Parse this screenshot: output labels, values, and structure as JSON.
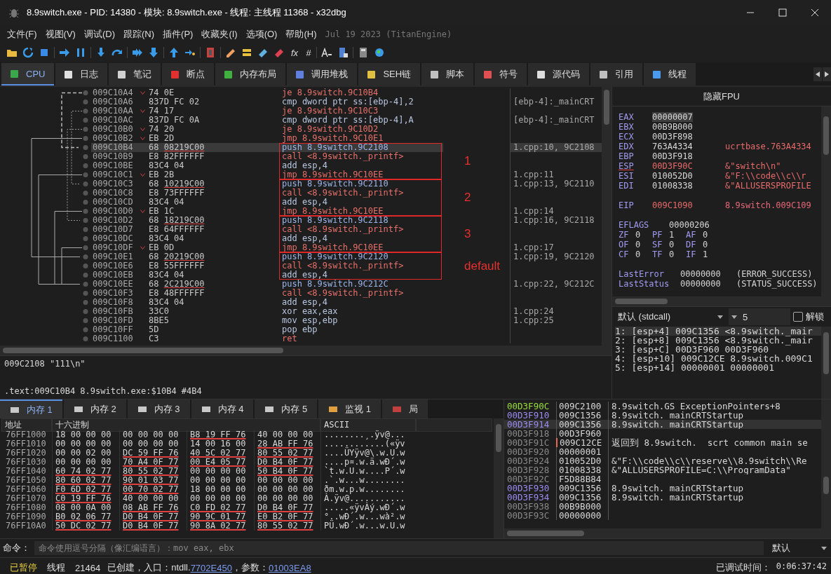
{
  "window": {
    "title": "8.9switch.exe - PID: 14380 - 模块: 8.9switch.exe - 线程: 主线程 11368 - x32dbg"
  },
  "menu": {
    "items": [
      "文件(F)",
      "视图(V)",
      "调试(D)",
      "跟踪(N)",
      "插件(P)",
      "收藏夹(I)",
      "选项(O)",
      "帮助(H)"
    ],
    "build_info": "Jul 19 2023 (TitanEngine)"
  },
  "toolbar": {
    "glyphs": [
      "fx",
      "#"
    ]
  },
  "tabs": [
    {
      "label": "CPU",
      "selected": true
    },
    {
      "label": "日志",
      "selected": false
    },
    {
      "label": "笔记",
      "selected": false
    },
    {
      "label": "断点",
      "selected": false
    },
    {
      "label": "内存布局",
      "selected": false
    },
    {
      "label": "调用堆栈",
      "selected": false
    },
    {
      "label": "SEH链",
      "selected": false
    },
    {
      "label": "脚本",
      "selected": false
    },
    {
      "label": "符号",
      "selected": false
    },
    {
      "label": "源代码",
      "selected": false
    },
    {
      "label": "引用",
      "selected": false
    },
    {
      "label": "线程",
      "selected": false
    }
  ],
  "disassembly": {
    "sections": [
      {
        "rows": [
          {
            "address": "009C10A4",
            "opcode": "74 0E",
            "jump": true,
            "instruction": "je 8.9switch.9C10B4",
            "kind": "jump",
            "selected": false
          },
          {
            "address": "009C10A6",
            "opcode": "837D FC 02",
            "jump": false,
            "instruction": "cmp dword ptr ss:[ebp-4],2",
            "kind": "cmp",
            "comment": "[ebp-4]:_mainCRT",
            "selected": false
          },
          {
            "address": "009C10AA",
            "opcode": "74 17",
            "jump": true,
            "instruction": "je 8.9switch.9C10C3",
            "kind": "jump",
            "selected": false
          },
          {
            "address": "009C10AC",
            "opcode": "837D FC 0A",
            "jump": false,
            "instruction": "cmp dword ptr ss:[ebp-4],A",
            "kind": "cmp",
            "comment": "[ebp-4]:_mainCRT",
            "selected": false
          },
          {
            "address": "009C10B0",
            "opcode": "74 20",
            "jump": true,
            "instruction": "je 8.9switch.9C10D2",
            "kind": "jump",
            "selected": false
          },
          {
            "address": "009C10B2",
            "opcode": "EB 2D",
            "jump": true,
            "instruction": "jmp 8.9switch.9C10E1",
            "kind": "jump",
            "selected": false
          }
        ]
      },
      {
        "annotation": "1",
        "rows": [
          {
            "address": "009C10B4",
            "opcode": "68",
            "operand": "08219C00",
            "jump": false,
            "instruction": "push 8.9switch.9C2108",
            "kind": "push",
            "comment": "1.cpp:10, 9C2108",
            "selected": true
          },
          {
            "address": "009C10B9",
            "opcode": "E8 82FFFFFF",
            "jump": false,
            "instruction": "call <8.9switch._printf>",
            "kind": "call",
            "selected": false
          },
          {
            "address": "009C10BE",
            "opcode": "83C4 04",
            "jump": false,
            "instruction": "add esp,4",
            "kind": "other",
            "selected": false
          },
          {
            "address": "009C10C1",
            "opcode": "EB 2B",
            "jump": true,
            "instruction": "jmp 8.9switch.9C10EE",
            "kind": "jump",
            "comment": "1.cpp:11",
            "selected": false
          }
        ]
      },
      {
        "annotation": "2",
        "rows": [
          {
            "address": "009C10C3",
            "opcode": "68",
            "operand": "10219C00",
            "jump": false,
            "instruction": "push 8.9switch.9C2110",
            "kind": "push",
            "comment": "1.cpp:13, 9C2110",
            "selected": false
          },
          {
            "address": "009C10C8",
            "opcode": "E8 73FFFFFF",
            "jump": false,
            "instruction": "call <8.9switch._printf>",
            "kind": "call",
            "selected": false
          },
          {
            "address": "009C10CD",
            "opcode": "83C4 04",
            "jump": false,
            "instruction": "add esp,4",
            "kind": "other",
            "selected": false
          },
          {
            "address": "009C10D0",
            "opcode": "EB 1C",
            "jump": true,
            "instruction": "jmp 8.9switch.9C10EE",
            "kind": "jump",
            "comment": "1.cpp:14",
            "selected": false
          }
        ]
      },
      {
        "annotation": "3",
        "rows": [
          {
            "address": "009C10D2",
            "opcode": "68",
            "operand": "18219C00",
            "jump": false,
            "instruction": "push 8.9switch.9C2118",
            "kind": "push",
            "comment": "1.cpp:16, 9C2118",
            "selected": false
          },
          {
            "address": "009C10D7",
            "opcode": "E8 64FFFFFF",
            "jump": false,
            "instruction": "call <8.9switch._printf>",
            "kind": "call",
            "selected": false
          },
          {
            "address": "009C10DC",
            "opcode": "83C4 04",
            "jump": false,
            "instruction": "add esp,4",
            "kind": "other",
            "selected": false
          },
          {
            "address": "009C10DF",
            "opcode": "EB 0D",
            "jump": true,
            "instruction": "jmp 8.9switch.9C10EE",
            "kind": "jump",
            "comment": "1.cpp:17",
            "selected": false
          }
        ]
      },
      {
        "annotation": "default",
        "rows": [
          {
            "address": "009C10E1",
            "opcode": "68",
            "operand": "20219C00",
            "jump": false,
            "instruction": "push 8.9switch.9C2120",
            "kind": "push",
            "comment": "1.cpp:19, 9C2120",
            "selected": false
          },
          {
            "address": "009C10E6",
            "opcode": "E8 55FFFFFF",
            "jump": false,
            "instruction": "call <8.9switch._printf>",
            "kind": "call",
            "selected": false
          },
          {
            "address": "009C10EB",
            "opcode": "83C4 04",
            "jump": false,
            "instruction": "add esp,4",
            "kind": "other",
            "selected": false
          }
        ]
      },
      {
        "rows": [
          {
            "address": "009C10EE",
            "opcode": "68",
            "operand": "2C219C00",
            "jump": false,
            "instruction": "push 8.9switch.9C212C",
            "kind": "push",
            "comment": "1.cpp:22, 9C212C",
            "selected": false
          },
          {
            "address": "009C10F3",
            "opcode": "E8 48FFFFFF",
            "jump": false,
            "instruction": "call <8.9switch._printf>",
            "kind": "call",
            "selected": false
          },
          {
            "address": "009C10F8",
            "opcode": "83C4 04",
            "jump": false,
            "instruction": "add esp,4",
            "kind": "other",
            "selected": false
          },
          {
            "address": "009C10FB",
            "opcode": "33C0",
            "jump": false,
            "instruction": "xor eax,eax",
            "kind": "other",
            "comment": "1.cpp:24",
            "selected": false
          },
          {
            "address": "009C10FD",
            "opcode": "8BE5",
            "jump": false,
            "instruction": "mov esp,ebp",
            "kind": "other",
            "comment": "1.cpp:25",
            "selected": false
          },
          {
            "address": "009C10FF",
            "opcode": "5D",
            "jump": false,
            "instruction": "pop ebp",
            "kind": "other",
            "selected": false
          },
          {
            "address": "009C1100",
            "opcode": "C3",
            "jump": false,
            "instruction": "ret",
            "kind": "ret",
            "selected": false
          }
        ]
      }
    ]
  },
  "info": {
    "lines": [
      "009C2108 \"111\\n\"",
      ".text:009C10B4 8.9switch.exe:$10B4 #4B4"
    ]
  },
  "registers": {
    "fpu_button": "隐藏FPU",
    "general": [
      {
        "name": "EAX",
        "value": "00000007",
        "modified": false,
        "selected": true
      },
      {
        "name": "EBX",
        "value": "00B9B000",
        "modified": false,
        "selected": false
      },
      {
        "name": "ECX",
        "value": "00D3F898",
        "modified": false,
        "selected": false
      },
      {
        "name": "EDX",
        "value": "763A4334",
        "comment": "ucrtbase.763A4334",
        "modified": false,
        "selected": false
      },
      {
        "name": "EBP",
        "value": "00D3F918",
        "modified": false,
        "selected": false
      },
      {
        "name": "ESP",
        "value": "00D3F90C",
        "comment": "&\"switch\\n\"",
        "modified": true,
        "selected": false
      },
      {
        "name": "ESI",
        "value": "010052D0",
        "comment": "&\"F:\\\\code\\\\c\\\\r",
        "modified": false,
        "selected": false
      },
      {
        "name": "EDI",
        "value": "01008338",
        "comment": "&\"ALLUSERSPROFILE",
        "modified": false,
        "selected": false
      }
    ],
    "eip": {
      "name": "EIP",
      "value": "009C1090",
      "comment": "8.9switch.009C109"
    },
    "eflags": {
      "name": "EFLAGS",
      "value": "00000206"
    },
    "flags": [
      {
        "name": "ZF",
        "value": "0"
      },
      {
        "name": "PF",
        "value": "1"
      },
      {
        "name": "AF",
        "value": "0"
      },
      {
        "name": "OF",
        "value": "0"
      },
      {
        "name": "SF",
        "value": "0"
      },
      {
        "name": "DF",
        "value": "0"
      },
      {
        "name": "CF",
        "value": "0"
      },
      {
        "name": "TF",
        "value": "0"
      },
      {
        "name": "IF",
        "value": "1"
      }
    ],
    "status": [
      {
        "name": "LastError",
        "value": "00000000",
        "description": "(ERROR_SUCCESS)"
      },
      {
        "name": "LastStatus",
        "value": "00000000",
        "description": "(STATUS_SUCCESS)"
      }
    ]
  },
  "call_convention": {
    "dropdown": "默认 (stdcall)",
    "count": "5",
    "unlock_label": "解锁",
    "unlock_checked": false
  },
  "arguments": [
    "1: [esp+4] 009C1356 <8.9switch._mair",
    "2: [esp+8] 009C1356 <8.9switch._mair",
    "3: [esp+C] 00D3F960 00D3F960",
    "4: [esp+10] 009C12CE 8.9switch.009C1",
    "5: [esp+14] 00000001 00000001"
  ],
  "memory_tabs": [
    {
      "label": "内存 1",
      "selected": true
    },
    {
      "label": "内存 2",
      "selected": false
    },
    {
      "label": "内存 3",
      "selected": false
    },
    {
      "label": "内存 4",
      "selected": false
    },
    {
      "label": "内存 5",
      "selected": false
    },
    {
      "label": "监视 1",
      "selected": false
    },
    {
      "label": "局",
      "selected": false
    }
  ],
  "memory": {
    "columns": [
      "地址",
      "十六进制",
      "ASCII"
    ],
    "rows": [
      {
        "address": "76FF1000",
        "groups": [
          {
            "bytes": "18 00 00 00",
            "pointer": false
          },
          {
            "bytes": "00 00 00 00",
            "pointer": false
          },
          {
            "bytes": "B8 19 FF 76",
            "pointer": true
          },
          {
            "bytes": "40 00 00 00",
            "pointer": false
          }
        ],
        "ascii": "........¸.ÿv@..."
      },
      {
        "address": "76FF1010",
        "groups": [
          {
            "bytes": "00 00 00 00",
            "pointer": false
          },
          {
            "bytes": "00 00 00 00",
            "pointer": false
          },
          {
            "bytes": "14 00 16 00",
            "pointer": false
          },
          {
            "bytes": "28 AB FF 76",
            "pointer": true
          }
        ],
        "ascii": "............(«ÿv"
      },
      {
        "address": "76FF1020",
        "groups": [
          {
            "bytes": "00 00 02 00",
            "pointer": false
          },
          {
            "bytes": "DC 59 FF 76",
            "pointer": true
          },
          {
            "bytes": "40 5C 02 77",
            "pointer": true
          },
          {
            "bytes": "80 55 02 77",
            "pointer": true
          }
        ],
        "ascii": "....ÜYÿv@\\.w.U.w"
      },
      {
        "address": "76FF1030",
        "groups": [
          {
            "bytes": "00 00 00 00",
            "pointer": false
          },
          {
            "bytes": "70 A4 0F 77",
            "pointer": true
          },
          {
            "bytes": "00 E4 05 77",
            "pointer": true
          },
          {
            "bytes": "D0 B4 0F 77",
            "pointer": true
          }
        ],
        "ascii": "....p¤.w.ä.wÐ´.w"
      },
      {
        "address": "76FF1040",
        "groups": [
          {
            "bytes": "60 74 02 77",
            "pointer": true
          },
          {
            "bytes": "80 55 02 77",
            "pointer": true
          },
          {
            "bytes": "00 00 00 00",
            "pointer": false
          },
          {
            "bytes": "50 B4 0F 77",
            "pointer": true
          }
        ],
        "ascii": "`t.w.U.w....P´.w"
      },
      {
        "address": "76FF1050",
        "groups": [
          {
            "bytes": "80 60 02 77",
            "pointer": true
          },
          {
            "bytes": "90 01 03 77",
            "pointer": true
          },
          {
            "bytes": "00 00 00 00",
            "pointer": false
          },
          {
            "bytes": "00 00 00 00",
            "pointer": false
          }
        ],
        "ascii": ".`.w...w........"
      },
      {
        "address": "76FF1060",
        "groups": [
          {
            "bytes": "F0 6D 02 77",
            "pointer": true
          },
          {
            "bytes": "00 70 02 77",
            "pointer": true
          },
          {
            "bytes": "18 00 00 00",
            "pointer": false
          },
          {
            "bytes": "00 00 00 00",
            "pointer": false
          }
        ],
        "ascii": "ðm.w.p.w........"
      },
      {
        "address": "76FF1070",
        "groups": [
          {
            "bytes": "C0 19 FF 76",
            "pointer": true
          },
          {
            "bytes": "40 00 00 00",
            "pointer": false
          },
          {
            "bytes": "00 00 00 00",
            "pointer": false
          },
          {
            "bytes": "00 00 00 00",
            "pointer": false
          }
        ],
        "ascii": "À.ÿv@..........."
      },
      {
        "address": "76FF1080",
        "groups": [
          {
            "bytes": "08 00 0A 00",
            "pointer": false
          },
          {
            "bytes": "08 AB FF 76",
            "pointer": true
          },
          {
            "bytes": "C0 FD 02 77",
            "pointer": true
          },
          {
            "bytes": "D0 B4 0F 77",
            "pointer": true
          }
        ],
        "ascii": ".....«ÿvÀý.wÐ´.w"
      },
      {
        "address": "76FF1090",
        "groups": [
          {
            "bytes": "B0 02 06 77",
            "pointer": true
          },
          {
            "bytes": "D0 B4 0F 77",
            "pointer": true
          },
          {
            "bytes": "90 9C 01 77",
            "pointer": true
          },
          {
            "bytes": "E0 B2 0F 77",
            "pointer": true
          }
        ],
        "ascii": "°..wÐ´.w...wà².w"
      },
      {
        "address": "76FF10A0",
        "groups": [
          {
            "bytes": "50 DC 02 77",
            "pointer": true
          },
          {
            "bytes": "D0 B4 0F 77",
            "pointer": true
          },
          {
            "bytes": "90 8A 02 77",
            "pointer": true
          },
          {
            "bytes": "80 55 02 77",
            "pointer": true
          }
        ],
        "ascii": "PÜ.wÐ´.w...w.U.w"
      }
    ]
  },
  "stack": {
    "rows": [
      {
        "address": "00D3F90C",
        "value": "009C2100",
        "comment": "8.9switch.GS_ExceptionPointers+8",
        "kind": "top",
        "selected": false
      },
      {
        "address": "00D3F910",
        "value": "009C1356",
        "comment": "8.9switch._mainCRTStartup",
        "kind": "code",
        "selected": false
      },
      {
        "address": "00D3F914",
        "value": "009C1356",
        "comment": "8.9switch._mainCRTStartup",
        "kind": "code",
        "selected": true
      },
      {
        "address": "00D3F918",
        "value": "00D3F960",
        "kind": "normal",
        "selected": false
      },
      {
        "address": "00D3F91C",
        "value": "009C12CE",
        "comment": "返回到 8.9switch.__scrt_common_main_se",
        "kind": "return",
        "selected": false
      },
      {
        "address": "00D3F920",
        "value": "00000001",
        "kind": "normal",
        "selected": false
      },
      {
        "address": "00D3F924",
        "value": "010052D0",
        "comment": "&\"F:\\\\code\\\\c\\\\reserve\\\\8.9switch\\\\Re",
        "kind": "normal",
        "selected": false
      },
      {
        "address": "00D3F928",
        "value": "01008338",
        "comment": "&\"ALLUSERSPROFILE=C:\\\\ProgramData\"",
        "kind": "normal",
        "selected": false
      },
      {
        "address": "00D3F92C",
        "value": "F5D88B84",
        "kind": "normal",
        "selected": false
      },
      {
        "address": "00D3F930",
        "value": "009C1356",
        "comment": "8.9switch._mainCRTStartup",
        "kind": "code",
        "selected": false
      },
      {
        "address": "00D3F934",
        "value": "009C1356",
        "comment": "8.9switch._mainCRTStartup",
        "kind": "code",
        "selected": false
      },
      {
        "address": "00D3F938",
        "value": "00B9B000",
        "kind": "normal",
        "selected": false
      },
      {
        "address": "00D3F93C",
        "value": "00000000",
        "kind": "normal",
        "selected": false
      }
    ]
  },
  "command": {
    "label": "命令：",
    "placeholder": "命令使用逗号分隔（像汇编语言）：mov eax, ebx",
    "mode": "默认"
  },
  "status_bar": {
    "state": "已暂停",
    "thread_label": "线程",
    "thread_id": "21464",
    "created_text": "已创建，入口：ntdll.",
    "entry_link": "7702E450",
    "param_text": "，参数：",
    "param_link": "01003EA8",
    "elapsed_label": "已调试时间：",
    "elapsed": "0:06:37:42"
  }
}
